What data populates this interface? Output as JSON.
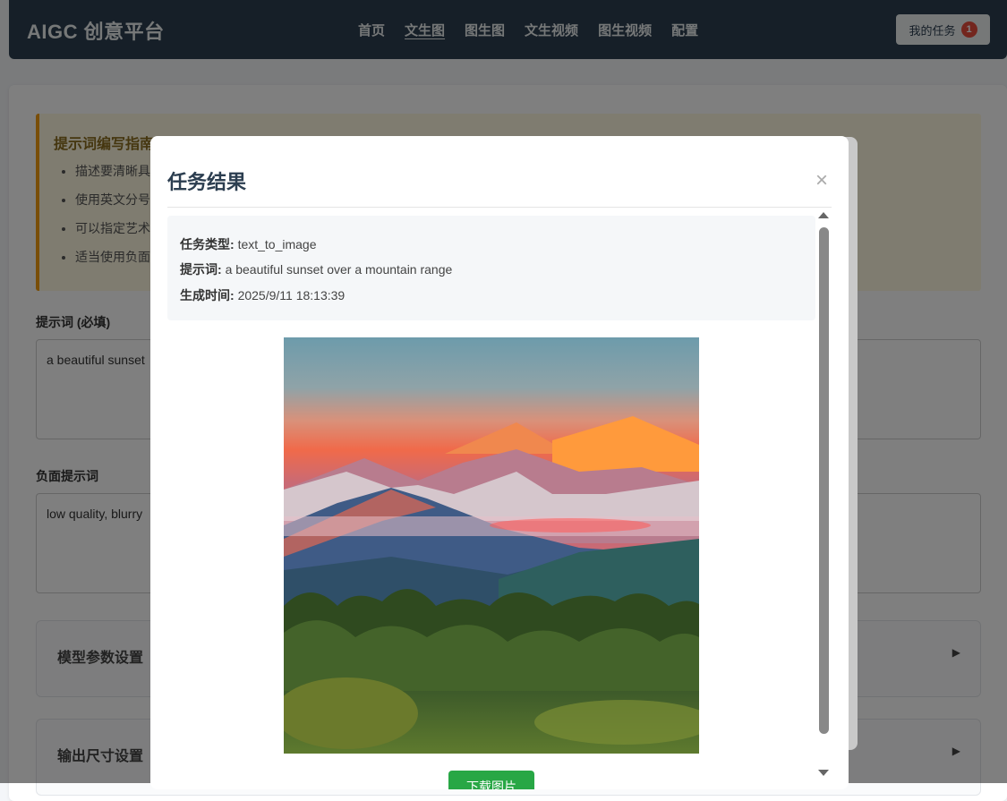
{
  "navbar": {
    "brand": "AIGC 创意平台",
    "links": [
      "首页",
      "文生图",
      "图生图",
      "文生视频",
      "图生视频",
      "配置"
    ],
    "active_index": 1,
    "tasks_label": "我的任务",
    "tasks_count": "1"
  },
  "guide": {
    "title": "提示词编写指南",
    "items": [
      "描述要清晰具",
      "使用英文分号",
      "可以指定艺术",
      "适当使用负面"
    ]
  },
  "form": {
    "prompt_label": "提示词 (必填)",
    "prompt_value": "a beautiful sunset",
    "negative_label": "负面提示词",
    "negative_value": "low quality, blurry",
    "sections": [
      "模型参数设置",
      "输出尺寸设置"
    ]
  },
  "modal": {
    "title": "任务结果",
    "close_glyph": "×",
    "task_type_label": "任务类型:",
    "task_type_value": "text_to_image",
    "prompt_label": "提示词:",
    "prompt_value": "a beautiful sunset over a mountain range",
    "time_label": "生成时间:",
    "time_value": "2025/9/11 18:13:39",
    "download_label": "下载图片"
  },
  "colors": {
    "navbar": "#2c3e50",
    "badge": "#e74c3c",
    "download": "#28a745",
    "guide_accent": "#f39c12"
  }
}
